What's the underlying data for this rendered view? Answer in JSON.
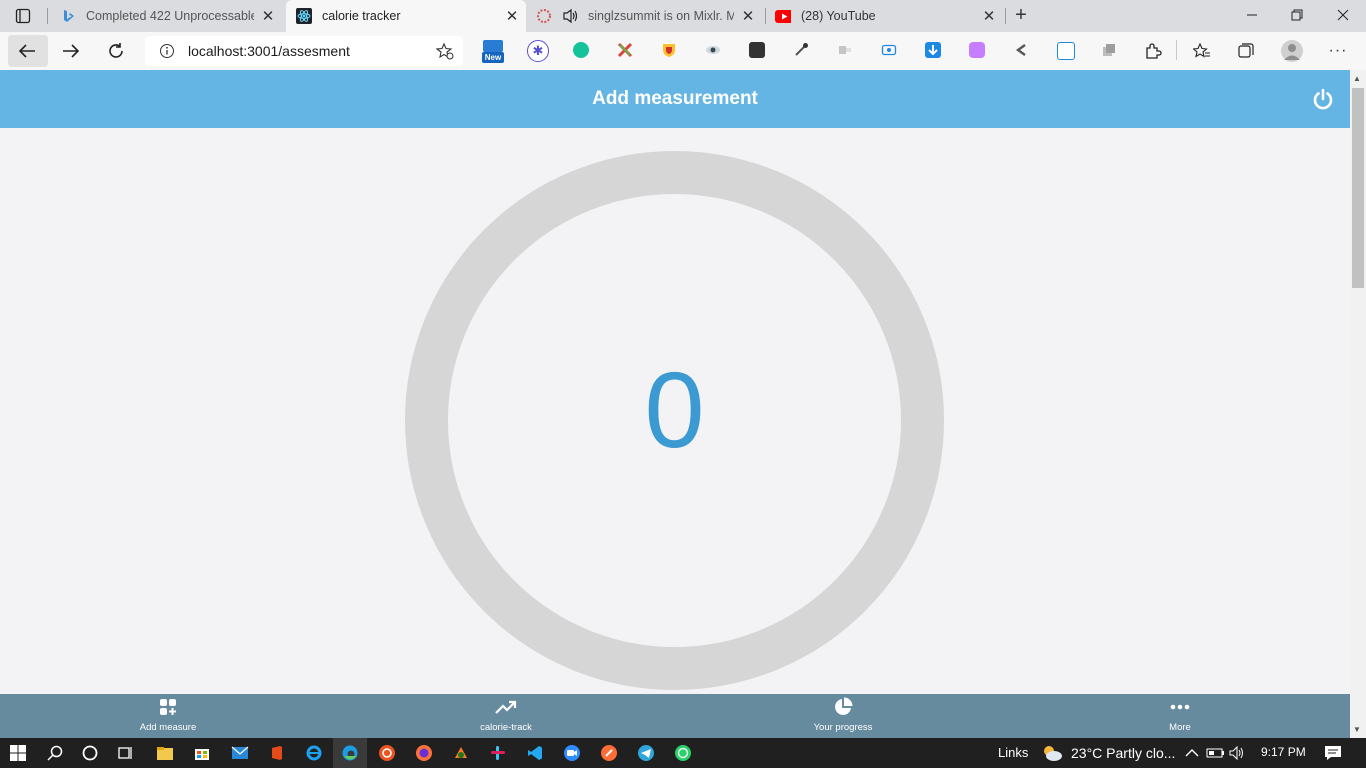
{
  "browser": {
    "tabs": [
      {
        "title": "Completed 422 Unprocessable E",
        "icon": "bing-icon"
      },
      {
        "title": "calorie tracker",
        "icon": "react-icon",
        "active": true
      },
      {
        "title": "singlzsummit is on Mixlr. M",
        "icon": "mixlr-icon"
      },
      {
        "title": "(28) YouTube",
        "icon": "youtube-icon"
      }
    ],
    "url": "localhost:3001/assesment",
    "new_badge": "New"
  },
  "app": {
    "header_title": "Add measurement",
    "calorie_value": "0",
    "nav": [
      {
        "label": "Add measure",
        "icon": "grid-add-icon"
      },
      {
        "label": "calorie-track",
        "icon": "trending-up-icon"
      },
      {
        "label": "Your progress",
        "icon": "pie-chart-icon"
      },
      {
        "label": "More",
        "icon": "more-dots-icon"
      }
    ],
    "colors": {
      "header": "#64b5e4",
      "nav": "#668a9e",
      "value": "#3b9ad2",
      "ring": "#d6d6d6"
    }
  },
  "taskbar": {
    "links": "Links",
    "weather": "23°C  Partly clo...",
    "time": "9:17 PM"
  }
}
